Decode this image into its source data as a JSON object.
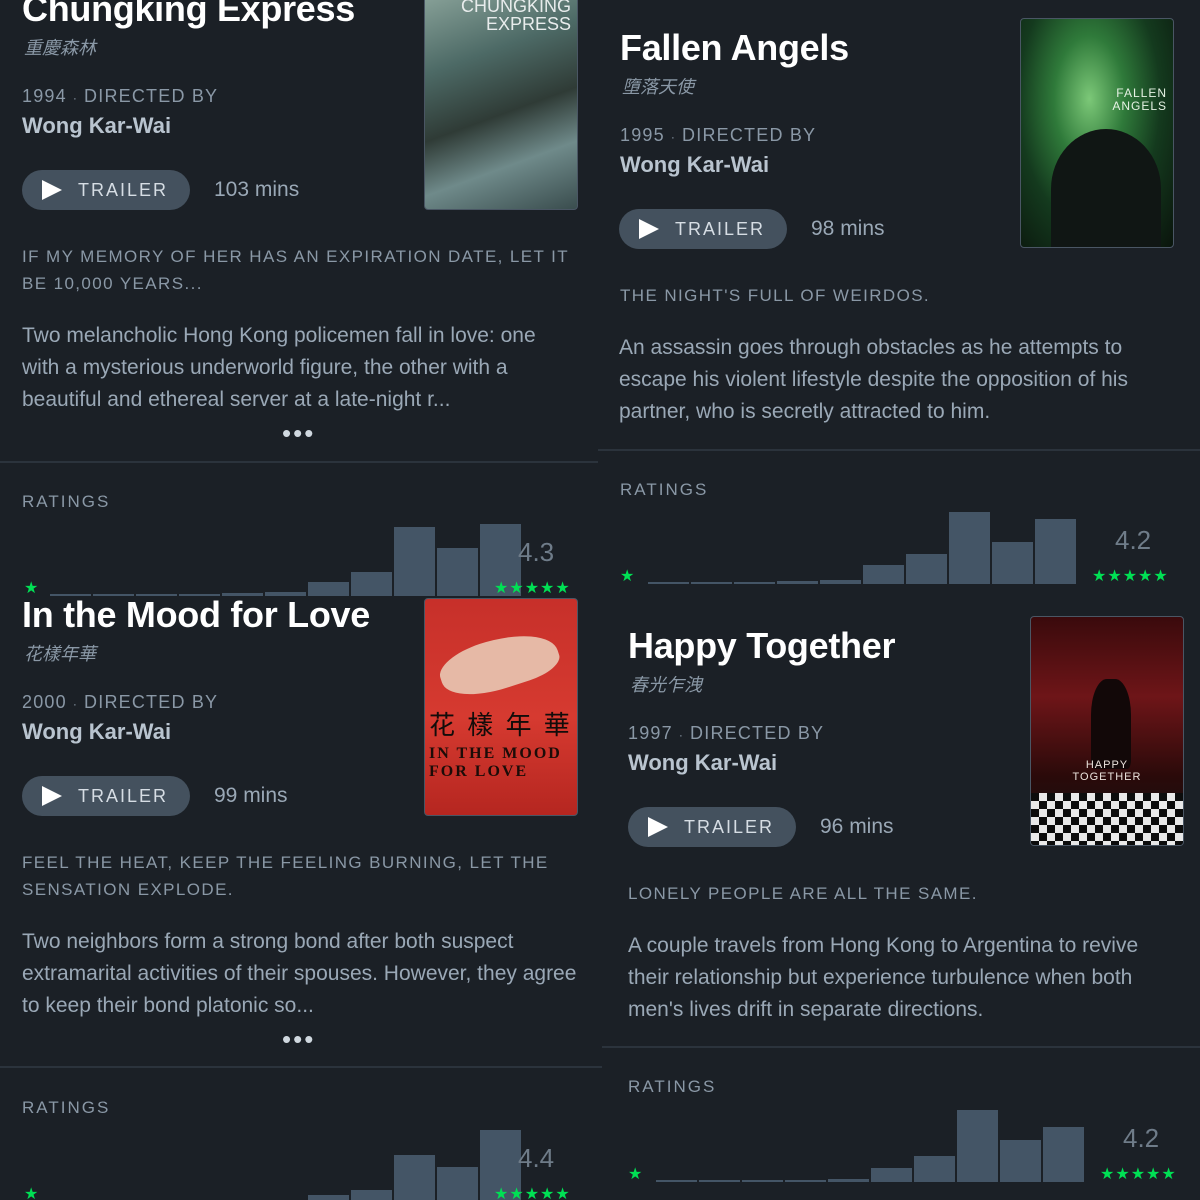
{
  "ui": {
    "trailer_label": "TRAILER",
    "directed_by": "DIRECTED BY",
    "ratings_label": "RATINGS",
    "more": "•••",
    "star_glyph": "★",
    "five_stars": "★★★★★",
    "accent_color": "#00e054",
    "bg_color": "#1b2026"
  },
  "films": [
    {
      "title": "Chungking Express",
      "original_title": "重慶森林",
      "year": "1994",
      "director": "Wong Kar-Wai",
      "runtime": "103 mins",
      "tagline": "IF MY MEMORY OF HER HAS AN EXPIRATION DATE, LET IT BE 10,000 YEARS...",
      "synopsis": "Two melancholic Hong Kong policemen fall in love: one with a mysterious underworld figure, the other with a beautiful and ethereal server at a late-night r...",
      "poster_text": "CHUNGKING EXPRESS",
      "poster_line1": "CHUNGKING",
      "poster_line2": "EXPRESS",
      "average_rating": "4.3",
      "histogram": [
        0.01,
        0.01,
        0.02,
        0.03,
        0.04,
        0.05,
        0.2,
        0.34,
        0.96,
        0.67,
        1.0
      ]
    },
    {
      "title": "Fallen Angels",
      "original_title": "墮落天使",
      "year": "1995",
      "director": "Wong Kar-Wai",
      "runtime": "98 mins",
      "tagline": "THE NIGHT'S FULL OF WEIRDOS.",
      "synopsis": "An assassin goes through obstacles as he attempts to escape his violent lifestyle despite the opposition of his partner, who is secretly attracted to him.",
      "poster_line1": "FALLEN",
      "poster_line2": "ANGELS",
      "average_rating": "4.2",
      "histogram": [
        0.01,
        0.01,
        0.01,
        0.04,
        0.06,
        0.27,
        0.42,
        1.0,
        0.59,
        0.9
      ]
    },
    {
      "title": "In the Mood for Love",
      "original_title": "花樣年華",
      "year": "2000",
      "director": "Wong Kar-Wai",
      "runtime": "99 mins",
      "tagline": "FEEL THE HEAT, KEEP THE FEELING BURNING, LET THE SENSATION EXPLODE.",
      "synopsis": "Two neighbors form a strong bond after both suspect extramarital activities of their spouses. However, they agree to keep their bond platonic so...",
      "poster_chinese": "花 樣 年 華",
      "poster_line1": "IN THE MOOD",
      "poster_line2": "FOR LOVE",
      "average_rating": "4.4",
      "histogram": [
        0.0,
        0.0,
        0.0,
        0.0,
        0.0,
        0.0,
        0.1,
        0.17,
        0.65,
        0.48,
        1.0
      ]
    },
    {
      "title": "Happy Together",
      "original_title": "春光乍洩",
      "year": "1997",
      "director": "Wong Kar-Wai",
      "runtime": "96 mins",
      "tagline": "LONELY PEOPLE ARE ALL THE SAME.",
      "synopsis": "A couple travels from Hong Kong to Argentina to revive their relationship but experience turbulence when both men's lives drift in separate directions.",
      "poster_line1": "HAPPY",
      "poster_line2": "TOGETHER",
      "average_rating": "4.2",
      "histogram": [
        0.01,
        0.01,
        0.01,
        0.02,
        0.04,
        0.2,
        0.36,
        1.0,
        0.59,
        0.76
      ]
    }
  ]
}
